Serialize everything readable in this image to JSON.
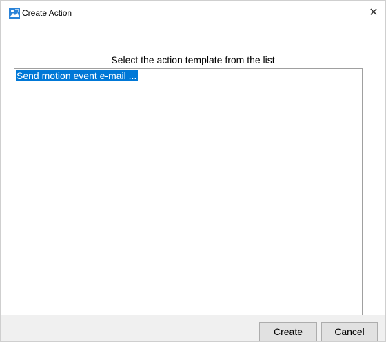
{
  "window": {
    "title": "Create Action",
    "close_glyph": "✕",
    "icon": "app-logo-icon"
  },
  "dialog": {
    "prompt": "Select the action template from the list",
    "templates": [
      {
        "label": "Send motion event e-mail ...",
        "selected": true
      }
    ]
  },
  "buttons": {
    "create_label": "Create",
    "cancel_label": "Cancel"
  },
  "colors": {
    "selection": "#0078d7",
    "icon_blue": "#2b83d8"
  }
}
